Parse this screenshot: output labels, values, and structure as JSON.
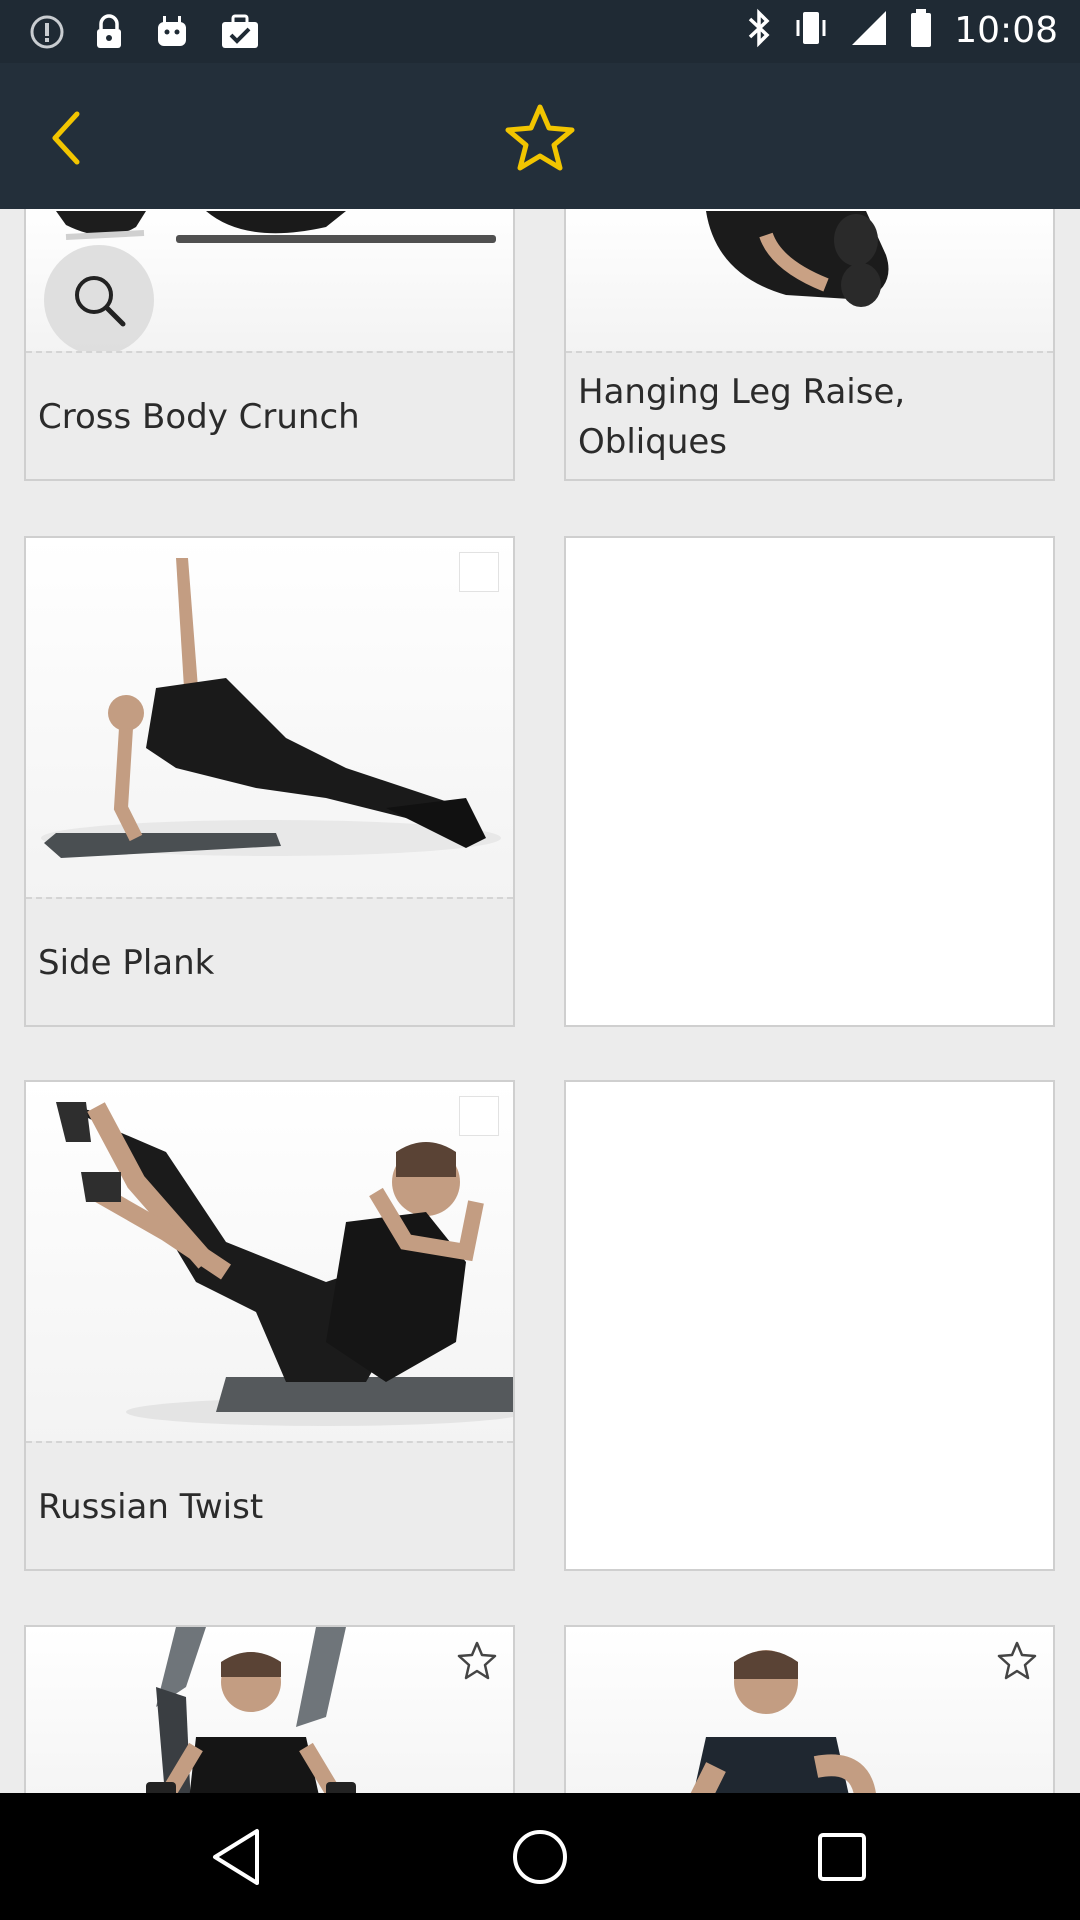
{
  "status_bar": {
    "time": "10:08",
    "left_icons": [
      "info-icon",
      "lock-icon",
      "android-icon",
      "briefcase-check-icon"
    ],
    "right_icons": [
      "bluetooth-icon",
      "vibrate-icon",
      "signal-icon",
      "battery-icon"
    ]
  },
  "app_bar": {
    "back_icon": "chevron-left-icon",
    "favorite_icon": "star-outline-icon",
    "accent_color": "#f2c500"
  },
  "exercises": [
    {
      "name": "Cross Body Crunch"
    },
    {
      "name": "Hanging Leg Raise, Obliques"
    },
    {
      "name": "Side Plank"
    },
    {
      "name": ""
    },
    {
      "name": "Russian Twist"
    },
    {
      "name": ""
    }
  ],
  "nav_bar": {
    "icons": [
      "back-triangle-icon",
      "home-circle-icon",
      "recents-square-icon"
    ]
  }
}
